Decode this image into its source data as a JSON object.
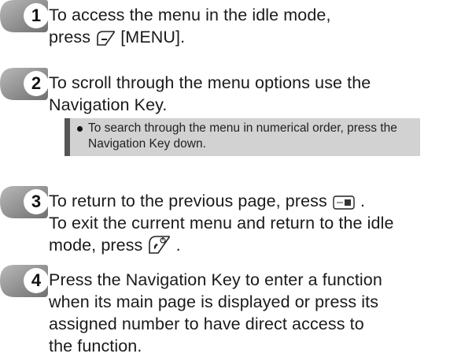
{
  "steps": [
    {
      "number": "1",
      "line1": "To access the menu in the idle mode,",
      "line2_before": "press",
      "line2_after": "[MENU].",
      "icon": "soft-key-icon"
    },
    {
      "number": "2",
      "line1": "To scroll through the menu options use the",
      "line2": "Navigation Key."
    },
    {
      "number": "3",
      "line1_before": "To return to the previous page, press",
      "line1_after": ".",
      "line2": "To exit the current menu and return to the idle",
      "line3_before": "mode, press",
      "line3_after": ".",
      "icons": [
        "clr-key-icon",
        "end-power-key-icon"
      ]
    },
    {
      "number": "4",
      "line1": "Press the Navigation Key to enter a function",
      "line2": "when its main page is displayed or press its",
      "line3": "assigned number to have direct access to",
      "line4": "the function."
    }
  ],
  "note": {
    "line1": "To search through the menu in numerical order, press the",
    "line2": "Navigation Key down."
  },
  "colors": {
    "note_background": "#d2d2d2",
    "note_bar": "#555555",
    "badge_gray": "#9a9a9a"
  }
}
